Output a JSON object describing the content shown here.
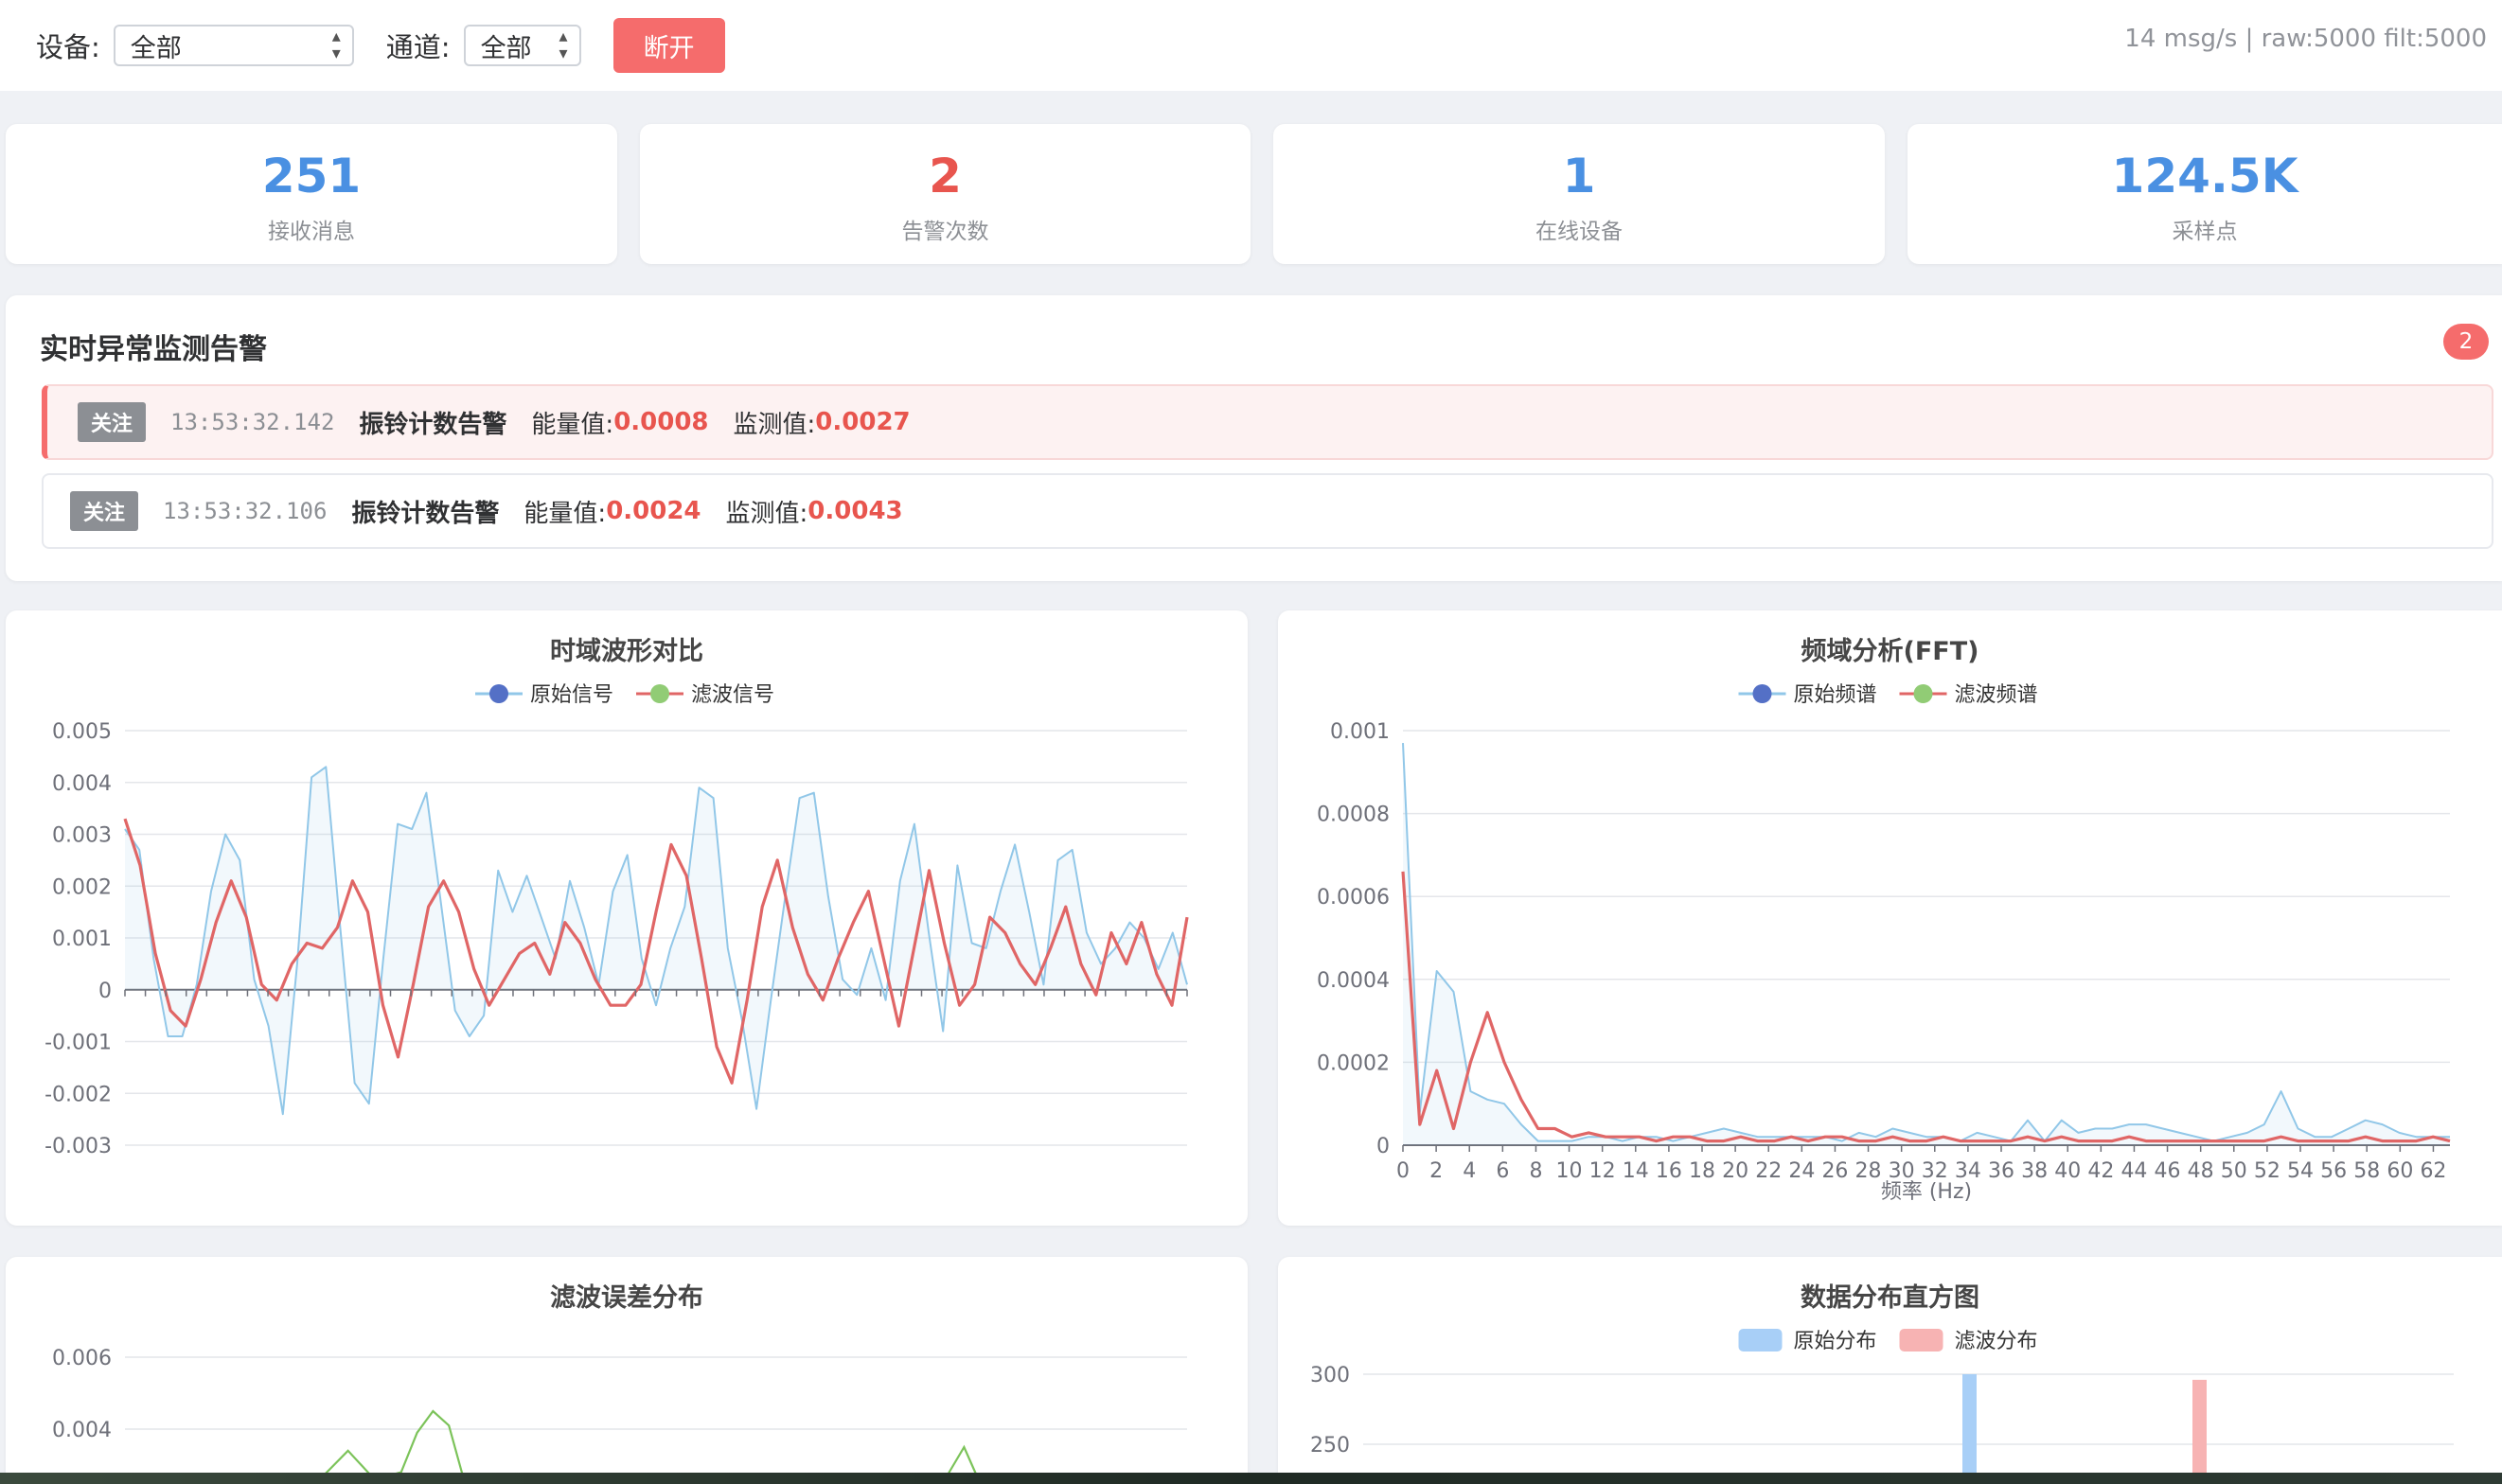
{
  "toolbar": {
    "device_label": "设备:",
    "device_value": "全部",
    "channel_label": "通道:",
    "channel_value": "全部",
    "disconnect_label": "断开",
    "status": "14 msg/s | raw:5000 filt:5000"
  },
  "stats": [
    {
      "value": "251",
      "label": "接收消息",
      "color": "#4a90e2"
    },
    {
      "value": "2",
      "label": "告警次数",
      "color": "#e8554e"
    },
    {
      "value": "1",
      "label": "在线设备",
      "color": "#4a90e2"
    },
    {
      "value": "124.5K",
      "label": "采样点",
      "color": "#4a90e2"
    }
  ],
  "alerts": {
    "title": "实时异常监测告警",
    "count": "2",
    "items": [
      {
        "tag": "关注",
        "time": "13:53:32.142",
        "title": "振铃计数告警",
        "energy_label": "能量值:",
        "energy": "0.0008",
        "detect_label": "监测值:",
        "detect": "0.0027"
      },
      {
        "tag": "关注",
        "time": "13:53:32.106",
        "title": "振铃计数告警",
        "energy_label": "能量值:",
        "energy": "0.0024",
        "detect_label": "监测值:",
        "detect": "0.0043"
      }
    ]
  },
  "colors": {
    "raw": "#91c7e8",
    "filtered": "#e06666",
    "error": "#7cc35a",
    "raw_hist": "#a8cff7",
    "filt_hist": "#f7b3b3"
  },
  "chart_data": [
    {
      "type": "line",
      "title": "时域波形对比",
      "legend": [
        "原始信号",
        "滤波信号"
      ],
      "ylim": [
        -0.003,
        0.005
      ],
      "yticks": [
        "0.005",
        "0.004",
        "0.003",
        "0.002",
        "0.001",
        "0",
        "-0.001",
        "-0.002",
        "-0.003"
      ],
      "series": [
        {
          "name": "原始信号",
          "values": [
            0.0031,
            0.0027,
            0.0006,
            -0.0009,
            -0.0009,
            0.0001,
            0.0019,
            0.003,
            0.0025,
            0.0002,
            -0.0007,
            -0.0024,
            0.0005,
            0.0041,
            0.0043,
            0.0012,
            -0.0018,
            -0.0022,
            0.0006,
            0.0032,
            0.0031,
            0.0038,
            0.0017,
            -0.0004,
            -0.0009,
            -0.0005,
            0.0023,
            0.0015,
            0.0022,
            0.0014,
            0.0006,
            0.0021,
            0.0012,
            0.0001,
            0.0019,
            0.0026,
            0.0006,
            -0.0003,
            0.0008,
            0.0016,
            0.0039,
            0.0037,
            0.0008,
            -0.0006,
            -0.0023,
            -0.0002,
            0.0018,
            0.0037,
            0.0038,
            0.0018,
            0.0002,
            -0.0001,
            0.0008,
            -0.0002,
            0.0021,
            0.0032,
            0.0011,
            -0.0008,
            0.0024,
            0.0009,
            0.0008,
            0.0019,
            0.0028,
            0.0015,
            0.0001,
            0.0025,
            0.0027,
            0.0011,
            0.0005,
            0.0008,
            0.0013,
            0.001,
            0.0004,
            0.0011,
            0.0001
          ]
        },
        {
          "name": "滤波信号",
          "values": [
            0.0033,
            0.0024,
            0.0007,
            -0.0004,
            -0.0007,
            0.0002,
            0.0013,
            0.0021,
            0.0014,
            0.0001,
            -0.0002,
            0.0005,
            0.0009,
            0.0008,
            0.0012,
            0.0021,
            0.0015,
            -0.0003,
            -0.0013,
            0.0001,
            0.0016,
            0.0021,
            0.0015,
            0.0004,
            -0.0003,
            0.0002,
            0.0007,
            0.0009,
            0.0003,
            0.0013,
            0.0009,
            0.0002,
            -0.0003,
            -0.0003,
            0.0001,
            0.0015,
            0.0028,
            0.0022,
            0.0006,
            -0.0011,
            -0.0018,
            -0.0002,
            0.0016,
            0.0025,
            0.0012,
            0.0003,
            -0.0002,
            0.0006,
            0.0013,
            0.0019,
            0.0006,
            -0.0007,
            0.0008,
            0.0023,
            0.0009,
            -0.0003,
            0.0001,
            0.0014,
            0.0011,
            0.0005,
            0.0001,
            0.0008,
            0.0016,
            0.0005,
            -0.0001,
            0.0011,
            0.0005,
            0.0013,
            0.0003,
            -0.0003,
            0.0014
          ]
        }
      ]
    },
    {
      "type": "line",
      "title": "频域分析(FFT)",
      "legend": [
        "原始频谱",
        "滤波频谱"
      ],
      "xlabel": "频率 (Hz)",
      "ylim": [
        0,
        0.001
      ],
      "yticks": [
        "0.001",
        "0.0008",
        "0.0006",
        "0.0004",
        "0.0002",
        "0"
      ],
      "xticks": [
        "0",
        "2",
        "4",
        "6",
        "8",
        "10",
        "12",
        "14",
        "16",
        "18",
        "20",
        "22",
        "24",
        "26",
        "28",
        "30",
        "32",
        "34",
        "36",
        "38",
        "40",
        "42",
        "44",
        "46",
        "48",
        "50",
        "52",
        "54",
        "56",
        "58",
        "60",
        "62"
      ],
      "series": [
        {
          "name": "原始频谱",
          "values": [
            0.00097,
            8e-05,
            0.00042,
            0.00037,
            0.00013,
            0.00011,
            0.0001,
            5e-05,
            1e-05,
            1e-05,
            1e-05,
            2e-05,
            2e-05,
            1e-05,
            2e-05,
            2e-05,
            1e-05,
            2e-05,
            3e-05,
            4e-05,
            3e-05,
            2e-05,
            2e-05,
            2e-05,
            2e-05,
            2e-05,
            1e-05,
            3e-05,
            2e-05,
            4e-05,
            3e-05,
            2e-05,
            2e-05,
            1e-05,
            3e-05,
            2e-05,
            1e-05,
            6e-05,
            1e-05,
            6e-05,
            3e-05,
            4e-05,
            4e-05,
            5e-05,
            5e-05,
            4e-05,
            3e-05,
            2e-05,
            1e-05,
            2e-05,
            3e-05,
            5e-05,
            0.00013,
            4e-05,
            2e-05,
            2e-05,
            4e-05,
            6e-05,
            5e-05,
            3e-05,
            2e-05,
            2e-05,
            2e-05
          ]
        },
        {
          "name": "滤波频谱",
          "values": [
            0.00066,
            5e-05,
            0.00018,
            4e-05,
            0.0002,
            0.00032,
            0.0002,
            0.00011,
            4e-05,
            4e-05,
            2e-05,
            3e-05,
            2e-05,
            2e-05,
            2e-05,
            1e-05,
            2e-05,
            2e-05,
            1e-05,
            1e-05,
            2e-05,
            1e-05,
            1e-05,
            2e-05,
            1e-05,
            2e-05,
            2e-05,
            1e-05,
            1e-05,
            2e-05,
            1e-05,
            1e-05,
            2e-05,
            1e-05,
            1e-05,
            1e-05,
            1e-05,
            2e-05,
            1e-05,
            2e-05,
            1e-05,
            1e-05,
            1e-05,
            2e-05,
            1e-05,
            1e-05,
            1e-05,
            1e-05,
            1e-05,
            1e-05,
            1e-05,
            1e-05,
            2e-05,
            1e-05,
            1e-05,
            1e-05,
            1e-05,
            2e-05,
            1e-05,
            1e-05,
            1e-05,
            2e-05,
            1e-05
          ]
        }
      ]
    },
    {
      "type": "area",
      "title": "滤波误差分布",
      "yticks": [
        "0.006",
        "0.004"
      ],
      "ylim": [
        0,
        0.007
      ],
      "series": [
        {
          "name": "",
          "points": [
            [
              0.18,
              0.0025
            ],
            [
              0.21,
              0.0034
            ],
            [
              0.235,
              0.0026
            ],
            [
              0.26,
              0.0028
            ],
            [
              0.275,
              0.0039
            ],
            [
              0.29,
              0.0045
            ],
            [
              0.305,
              0.0041
            ],
            [
              0.32,
              0.0025
            ],
            [
              0.77,
              0.0025
            ],
            [
              0.79,
              0.0035
            ],
            [
              0.805,
              0.0025
            ]
          ]
        }
      ]
    },
    {
      "type": "bar",
      "title": "数据分布直方图",
      "legend": [
        "原始分布",
        "滤波分布"
      ],
      "yticks": [
        "300",
        "250"
      ],
      "ylim": [
        200,
        320
      ],
      "series": [
        {
          "name": "原始分布",
          "values": [
            300
          ]
        },
        {
          "name": "滤波分布",
          "values": [
            296
          ]
        }
      ]
    }
  ]
}
